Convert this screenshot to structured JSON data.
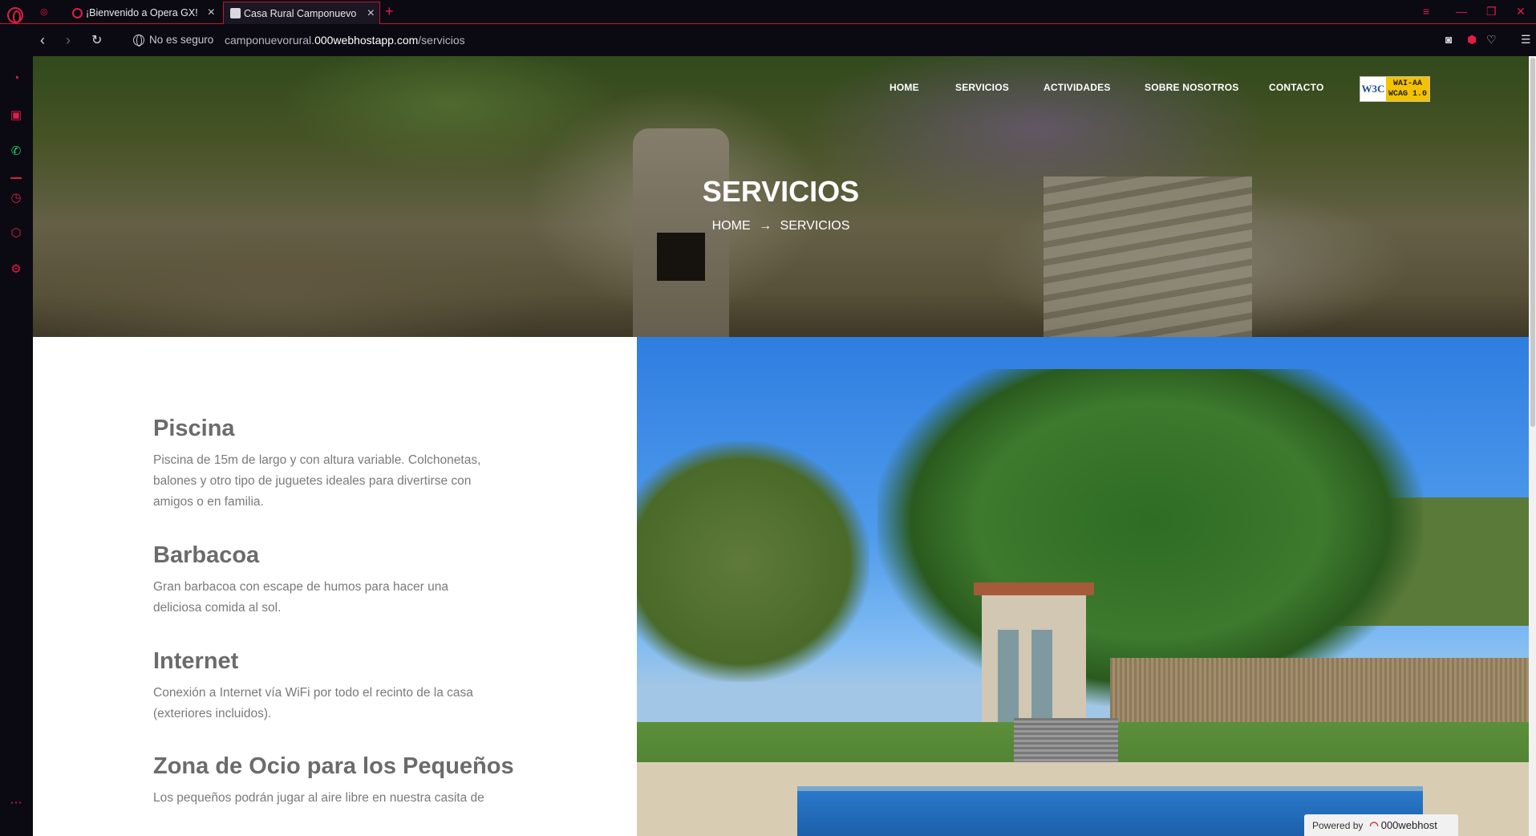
{
  "browser": {
    "tabs": [
      {
        "title": "¡Bienvenido a Opera GX!"
      },
      {
        "title": "Casa Rural Camponuevo"
      }
    ],
    "security_label": "No es seguro",
    "url_prefix": "camponuevorural.",
    "url_host": "000webhostapp.com",
    "url_path": "/servicios",
    "accent_color": "#e01e44"
  },
  "site": {
    "nav": [
      "HOME",
      "SERVICIOS",
      "ACTIVIDADES",
      "SOBRE NOSOTROS",
      "CONTACTO"
    ],
    "badge": {
      "left": "W3C",
      "line1": "WAI-AA",
      "line2": "WCAG 1.0"
    },
    "hero_title": "SERVICIOS",
    "breadcrumb": {
      "home": "HOME",
      "arrow": "→",
      "current": "SERVICIOS"
    },
    "services": [
      {
        "title": "Piscina",
        "text": "Piscina de 15m de largo y con altura variable. Colchonetas, balones y otro tipo de juguetes ideales para divertirse con amigos o en familia."
      },
      {
        "title": "Barbacoa",
        "text": "Gran barbacoa con escape de humos para hacer una deliciosa comida al sol."
      },
      {
        "title": "Internet",
        "text": "Conexión a Internet vía WiFi por todo el recinto de la casa (exteriores incluidos)."
      },
      {
        "title": "Zona de Ocio para los Pequeños",
        "text": "Los pequeños podrán jugar al aire libre en nuestra casita de"
      }
    ],
    "powered": {
      "label": "Powered by",
      "brand": "000webhost"
    }
  }
}
